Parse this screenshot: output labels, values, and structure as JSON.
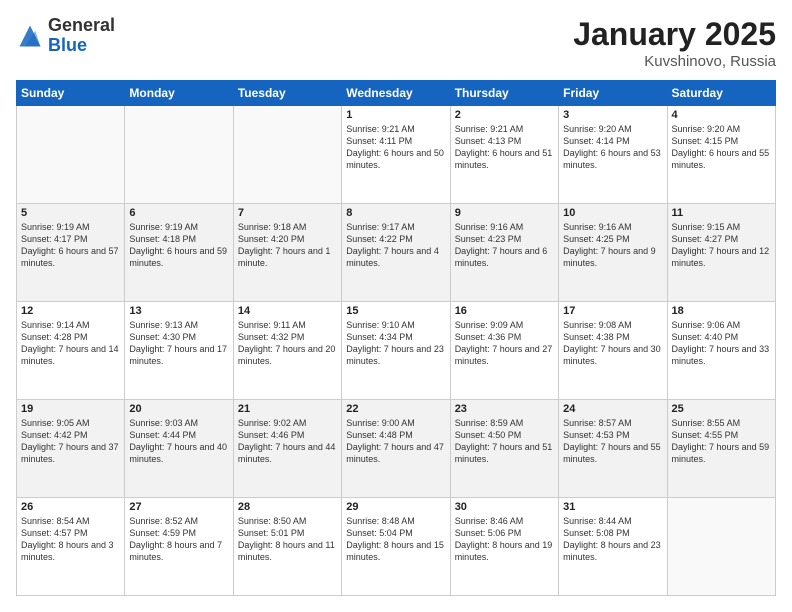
{
  "header": {
    "logo_line1": "General",
    "logo_line2": "Blue",
    "title": "January 2025",
    "subtitle": "Kuvshinovo, Russia"
  },
  "weekdays": [
    "Sunday",
    "Monday",
    "Tuesday",
    "Wednesday",
    "Thursday",
    "Friday",
    "Saturday"
  ],
  "weeks": [
    [
      {
        "day": "",
        "sunrise": "",
        "sunset": "",
        "daylight": ""
      },
      {
        "day": "",
        "sunrise": "",
        "sunset": "",
        "daylight": ""
      },
      {
        "day": "",
        "sunrise": "",
        "sunset": "",
        "daylight": ""
      },
      {
        "day": "1",
        "sunrise": "Sunrise: 9:21 AM",
        "sunset": "Sunset: 4:11 PM",
        "daylight": "Daylight: 6 hours and 50 minutes."
      },
      {
        "day": "2",
        "sunrise": "Sunrise: 9:21 AM",
        "sunset": "Sunset: 4:13 PM",
        "daylight": "Daylight: 6 hours and 51 minutes."
      },
      {
        "day": "3",
        "sunrise": "Sunrise: 9:20 AM",
        "sunset": "Sunset: 4:14 PM",
        "daylight": "Daylight: 6 hours and 53 minutes."
      },
      {
        "day": "4",
        "sunrise": "Sunrise: 9:20 AM",
        "sunset": "Sunset: 4:15 PM",
        "daylight": "Daylight: 6 hours and 55 minutes."
      }
    ],
    [
      {
        "day": "5",
        "sunrise": "Sunrise: 9:19 AM",
        "sunset": "Sunset: 4:17 PM",
        "daylight": "Daylight: 6 hours and 57 minutes."
      },
      {
        "day": "6",
        "sunrise": "Sunrise: 9:19 AM",
        "sunset": "Sunset: 4:18 PM",
        "daylight": "Daylight: 6 hours and 59 minutes."
      },
      {
        "day": "7",
        "sunrise": "Sunrise: 9:18 AM",
        "sunset": "Sunset: 4:20 PM",
        "daylight": "Daylight: 7 hours and 1 minute."
      },
      {
        "day": "8",
        "sunrise": "Sunrise: 9:17 AM",
        "sunset": "Sunset: 4:22 PM",
        "daylight": "Daylight: 7 hours and 4 minutes."
      },
      {
        "day": "9",
        "sunrise": "Sunrise: 9:16 AM",
        "sunset": "Sunset: 4:23 PM",
        "daylight": "Daylight: 7 hours and 6 minutes."
      },
      {
        "day": "10",
        "sunrise": "Sunrise: 9:16 AM",
        "sunset": "Sunset: 4:25 PM",
        "daylight": "Daylight: 7 hours and 9 minutes."
      },
      {
        "day": "11",
        "sunrise": "Sunrise: 9:15 AM",
        "sunset": "Sunset: 4:27 PM",
        "daylight": "Daylight: 7 hours and 12 minutes."
      }
    ],
    [
      {
        "day": "12",
        "sunrise": "Sunrise: 9:14 AM",
        "sunset": "Sunset: 4:28 PM",
        "daylight": "Daylight: 7 hours and 14 minutes."
      },
      {
        "day": "13",
        "sunrise": "Sunrise: 9:13 AM",
        "sunset": "Sunset: 4:30 PM",
        "daylight": "Daylight: 7 hours and 17 minutes."
      },
      {
        "day": "14",
        "sunrise": "Sunrise: 9:11 AM",
        "sunset": "Sunset: 4:32 PM",
        "daylight": "Daylight: 7 hours and 20 minutes."
      },
      {
        "day": "15",
        "sunrise": "Sunrise: 9:10 AM",
        "sunset": "Sunset: 4:34 PM",
        "daylight": "Daylight: 7 hours and 23 minutes."
      },
      {
        "day": "16",
        "sunrise": "Sunrise: 9:09 AM",
        "sunset": "Sunset: 4:36 PM",
        "daylight": "Daylight: 7 hours and 27 minutes."
      },
      {
        "day": "17",
        "sunrise": "Sunrise: 9:08 AM",
        "sunset": "Sunset: 4:38 PM",
        "daylight": "Daylight: 7 hours and 30 minutes."
      },
      {
        "day": "18",
        "sunrise": "Sunrise: 9:06 AM",
        "sunset": "Sunset: 4:40 PM",
        "daylight": "Daylight: 7 hours and 33 minutes."
      }
    ],
    [
      {
        "day": "19",
        "sunrise": "Sunrise: 9:05 AM",
        "sunset": "Sunset: 4:42 PM",
        "daylight": "Daylight: 7 hours and 37 minutes."
      },
      {
        "day": "20",
        "sunrise": "Sunrise: 9:03 AM",
        "sunset": "Sunset: 4:44 PM",
        "daylight": "Daylight: 7 hours and 40 minutes."
      },
      {
        "day": "21",
        "sunrise": "Sunrise: 9:02 AM",
        "sunset": "Sunset: 4:46 PM",
        "daylight": "Daylight: 7 hours and 44 minutes."
      },
      {
        "day": "22",
        "sunrise": "Sunrise: 9:00 AM",
        "sunset": "Sunset: 4:48 PM",
        "daylight": "Daylight: 7 hours and 47 minutes."
      },
      {
        "day": "23",
        "sunrise": "Sunrise: 8:59 AM",
        "sunset": "Sunset: 4:50 PM",
        "daylight": "Daylight: 7 hours and 51 minutes."
      },
      {
        "day": "24",
        "sunrise": "Sunrise: 8:57 AM",
        "sunset": "Sunset: 4:53 PM",
        "daylight": "Daylight: 7 hours and 55 minutes."
      },
      {
        "day": "25",
        "sunrise": "Sunrise: 8:55 AM",
        "sunset": "Sunset: 4:55 PM",
        "daylight": "Daylight: 7 hours and 59 minutes."
      }
    ],
    [
      {
        "day": "26",
        "sunrise": "Sunrise: 8:54 AM",
        "sunset": "Sunset: 4:57 PM",
        "daylight": "Daylight: 8 hours and 3 minutes."
      },
      {
        "day": "27",
        "sunrise": "Sunrise: 8:52 AM",
        "sunset": "Sunset: 4:59 PM",
        "daylight": "Daylight: 8 hours and 7 minutes."
      },
      {
        "day": "28",
        "sunrise": "Sunrise: 8:50 AM",
        "sunset": "Sunset: 5:01 PM",
        "daylight": "Daylight: 8 hours and 11 minutes."
      },
      {
        "day": "29",
        "sunrise": "Sunrise: 8:48 AM",
        "sunset": "Sunset: 5:04 PM",
        "daylight": "Daylight: 8 hours and 15 minutes."
      },
      {
        "day": "30",
        "sunrise": "Sunrise: 8:46 AM",
        "sunset": "Sunset: 5:06 PM",
        "daylight": "Daylight: 8 hours and 19 minutes."
      },
      {
        "day": "31",
        "sunrise": "Sunrise: 8:44 AM",
        "sunset": "Sunset: 5:08 PM",
        "daylight": "Daylight: 8 hours and 23 minutes."
      },
      {
        "day": "",
        "sunrise": "",
        "sunset": "",
        "daylight": ""
      }
    ]
  ]
}
